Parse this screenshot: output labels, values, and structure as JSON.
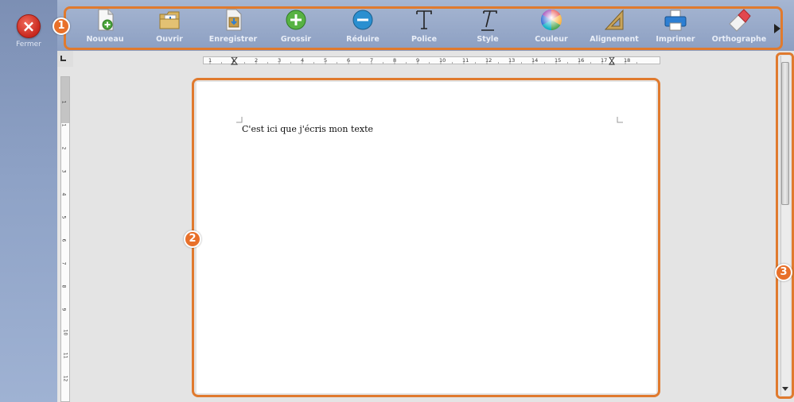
{
  "window": {
    "close_label": "Fermer",
    "close_glyph": "×"
  },
  "toolbar": {
    "items": [
      {
        "label": "Nouveau",
        "icon": "new-document-icon"
      },
      {
        "label": "Ouvrir",
        "icon": "folder-open-icon"
      },
      {
        "label": "Enregistrer",
        "icon": "save-icon"
      },
      {
        "label": "Grossir",
        "icon": "zoom-in-plus-icon"
      },
      {
        "label": "Réduire",
        "icon": "zoom-out-minus-icon"
      },
      {
        "label": "Police",
        "icon": "font-icon"
      },
      {
        "label": "Style",
        "icon": "italic-style-icon"
      },
      {
        "label": "Couleur",
        "icon": "color-wheel-icon"
      },
      {
        "label": "Alignement",
        "icon": "alignment-ruler-icon"
      },
      {
        "label": "Imprimer",
        "icon": "printer-icon"
      },
      {
        "label": "Orthographe",
        "icon": "eraser-spellcheck-icon"
      }
    ],
    "more_icon": "chevron-right-icon"
  },
  "ruler": {
    "horizontal_numbers": [
      "1",
      "1",
      "2",
      "3",
      "4",
      "5",
      "6",
      "7",
      "8",
      "9",
      "10",
      "11",
      "12",
      "13",
      "14",
      "15",
      "16",
      "17",
      "18"
    ],
    "vertical_numbers": [
      "1",
      "1",
      "2",
      "3",
      "4",
      "5",
      "6",
      "7",
      "8",
      "9",
      "10",
      "11",
      "12"
    ]
  },
  "document": {
    "text": "C'est ici que j'écris mon texte"
  },
  "callouts": {
    "toolbar": "1",
    "page": "2",
    "scrollbar": "3"
  },
  "colors": {
    "accent_orange": "#e07a2e",
    "sidebar_blue": "#8ea2c6",
    "close_red": "#d0342a"
  }
}
